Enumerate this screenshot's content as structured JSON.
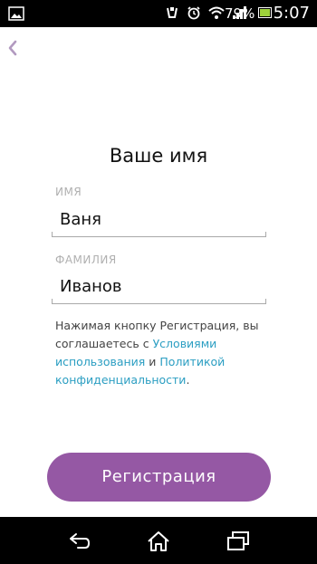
{
  "status_bar": {
    "battery_percent": "79%",
    "time": "5:07"
  },
  "screen": {
    "title": "Ваше имя",
    "first_name": {
      "label": "ИМЯ",
      "value": "Ваня"
    },
    "last_name": {
      "label": "ФАМИЛИЯ",
      "value": "Иванов"
    },
    "terms": {
      "text_before": "Нажимая кнопку Регистрация, вы соглашаетесь с ",
      "link_terms": "Условиями использования",
      "text_and": " и ",
      "link_privacy": "Политикой конфиденциальности",
      "text_end": "."
    },
    "register_button": "Регистрация"
  },
  "icons": {
    "back": "chevron-left-icon",
    "nav_back": "back-arrow-icon",
    "nav_home": "home-icon",
    "nav_recents": "recent-apps-icon"
  },
  "colors": {
    "accent": "#9558a4",
    "link": "#2b9ec2",
    "status_bar": "#000000"
  }
}
